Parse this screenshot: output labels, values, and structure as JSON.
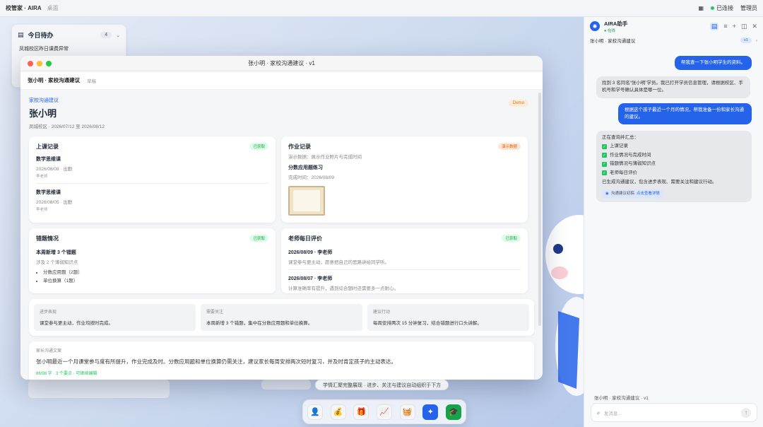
{
  "topbar": {
    "brand": "校管家 · AIRA",
    "sub": "桌面",
    "grid_icon": "grid-icon",
    "status": "已连接",
    "user": "管理员"
  },
  "todo": {
    "title": "今日待办",
    "count": "4",
    "item": "凤城校区昨日课费异常"
  },
  "window": {
    "title": "张小明 · 家校沟通建议 · v1",
    "subtitle": "张小明 · 家校沟通建议",
    "draft": "草稿",
    "eyebrow": "家校沟通建议",
    "demo": "Demo",
    "student_name": "张小明",
    "meta": "凤城校区 · 2026/07/12 至 2026/08/12",
    "attendance": {
      "title": "上课记录",
      "badge": "已获取",
      "records": [
        {
          "course": "数学思维课",
          "when": "2026/08/08 · 出勤",
          "teacher": "李老师"
        },
        {
          "course": "数学思维课",
          "when": "2026/08/05 · 出勤",
          "teacher": "李老师"
        }
      ]
    },
    "homework": {
      "title": "作业记录",
      "badge": "演示数据",
      "note": "演示数据：展示作业照片与完成时间",
      "item": "分数应用题练习",
      "done": "完成时间：2026/08/09"
    },
    "mistakes": {
      "title": "错题情况",
      "badge": "已获取",
      "headline": "本周新增 3 个错题",
      "sub": "涉及 2 个薄弱知识点",
      "points": [
        "分数应用题（2题）",
        "单位换算（1题）"
      ]
    },
    "evaluation": {
      "title": "老师每日评价",
      "badge": "已获取",
      "entries": [
        {
          "head": "2026/08/09 · 李老师",
          "body": "课堂参与更主动，愿意把自己的思路讲给同学听。"
        },
        {
          "head": "2026/08/07 · 李老师",
          "body": "计算准确率有提升，遇到综合题时还需要多一点耐心。"
        }
      ]
    },
    "summary": [
      {
        "label": "进步表现",
        "text": "课堂参与更主动，作业均按时完成。"
      },
      {
        "label": "需要关注",
        "text": "本周新增 3 个错题，集中在分数应用题和单位换算。"
      },
      {
        "label": "建议行动",
        "text": "每周安排两次 15 分钟复习，结合错题进行口头讲解。"
      }
    ],
    "copy": {
      "label": "家长沟通文案",
      "text": "张小明最近一个月课堂参与度有所提升，作业完成及时。分数应用题和单位换算仍需关注，建议家长每周安排两次短时复习，并及时肯定孩子的主动表达。",
      "foot": "86/98 字 · 3 个要点 · 可继续编辑"
    }
  },
  "hint": "学情汇聚完整展现 · 进步、关注与建议自动组织于下方",
  "dock": [
    "student-icon",
    "money-bag-icon",
    "gift-icon",
    "chart-icon",
    "basket-icon",
    "sparkle-icon",
    "learn-icon"
  ],
  "assistant": {
    "name": "AIRA助手",
    "status": "在线",
    "context": "张小明 · 家校沟通建议",
    "version": "v1",
    "msg1": "帮我查一下张小明学生的资料。",
    "msg2": "找到 3 名同名“张小明”学员。我已打开学员信息管理，请根据校区、手机号和学号确认具体是哪一位。",
    "msg3": "根据这个孩子最近一个月的情况，帮我准备一份和家长沟通的建议。",
    "msg4_head": "正在查询并汇总：",
    "checks": [
      "上课记录",
      "作业情况与完成时间",
      "错题情况与薄弱知识点",
      "老师每日评价"
    ],
    "msg4_done": "已生成沟通建议，包含进步表现、需要关注和建议行动。",
    "link_label": "沟通建议初稿",
    "link_action": "点击查看详情",
    "footer": "张小明 · 家校沟通建议 · v1",
    "input_placeholder": "发消息..."
  }
}
